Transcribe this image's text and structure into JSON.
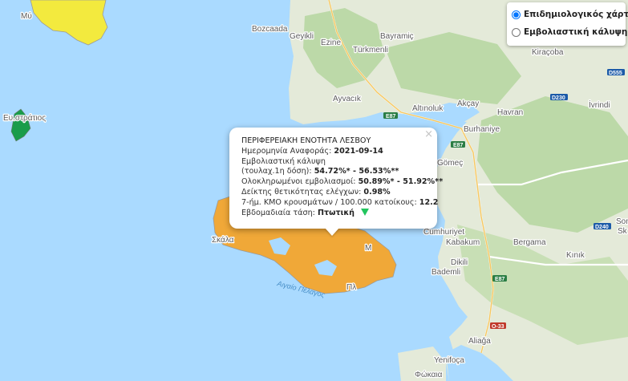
{
  "map": {
    "places": [
      "Bozcaada",
      "Geyikli",
      "Ezine",
      "Bayramiç",
      "Türkmenli",
      "Ayvacık",
      "Altınoluk",
      "Akçay",
      "Havran",
      "Burhaniye",
      "Gömeç",
      "Cumhuriyet",
      "Kabakum",
      "Dikili",
      "Bademli",
      "Bergama",
      "Kınık",
      "Aliağa",
      "Yenifoça",
      "Kiraçoba",
      "İvrindi",
      "Soma",
      "Sk",
      "Μύ",
      "Ευ.στράτιος",
      "Σκάλα",
      "Πλ",
      "Μ",
      "Φώκαια"
    ],
    "sea_label": "Αιγαίο Πέλαγος",
    "roads": [
      "E87",
      "E87",
      "E87",
      "D230",
      "D240",
      "D555",
      "O-33"
    ],
    "region_colors": {
      "lesvos": "#f0a838",
      "limnos": "#f3ea3e",
      "agios_efstratios": "#1a9c4a",
      "land": "#dfe8d5",
      "forest": "#b7d7a5",
      "sea": "#aadaff"
    }
  },
  "layer_control": {
    "options": [
      {
        "label": "Επιδημιολογικός χάρτης",
        "selected": true
      },
      {
        "label": "Εμβολιαστική κάλυψη",
        "selected": false
      }
    ]
  },
  "popup": {
    "close": "×",
    "title": "ΠΕΡΙΦΕΡΕΙΑΚΗ ΕΝΟΤΗΤΑ ΛΕΣΒΟΥ",
    "report_date_label": "Ημερομηνία Αναφοράς:",
    "report_date": "2021-09-14",
    "coverage_label": "Εμβολιαστική κάλυψη",
    "first_dose_label": "(τουλαχ.1η δόση):",
    "first_dose_value": "54.72%* - 56.53%**",
    "full_label": "Ολοκληρωμένοι εμβολιασμοί:",
    "full_value": "50.89%* - 51.92%**",
    "positivity_label": "Δείκτης θετικότητας ελέγχων:",
    "positivity_value": "0.98%",
    "cases_label": "7-ήμ. ΚΜΟ κρουσμάτων / 100.000 κατοίκους:",
    "cases_value": "12.2",
    "trend_label": "Εβδομαδιαία τάση:",
    "trend_value": "Πτωτική",
    "trend_icon": "down-triangle-icon"
  }
}
